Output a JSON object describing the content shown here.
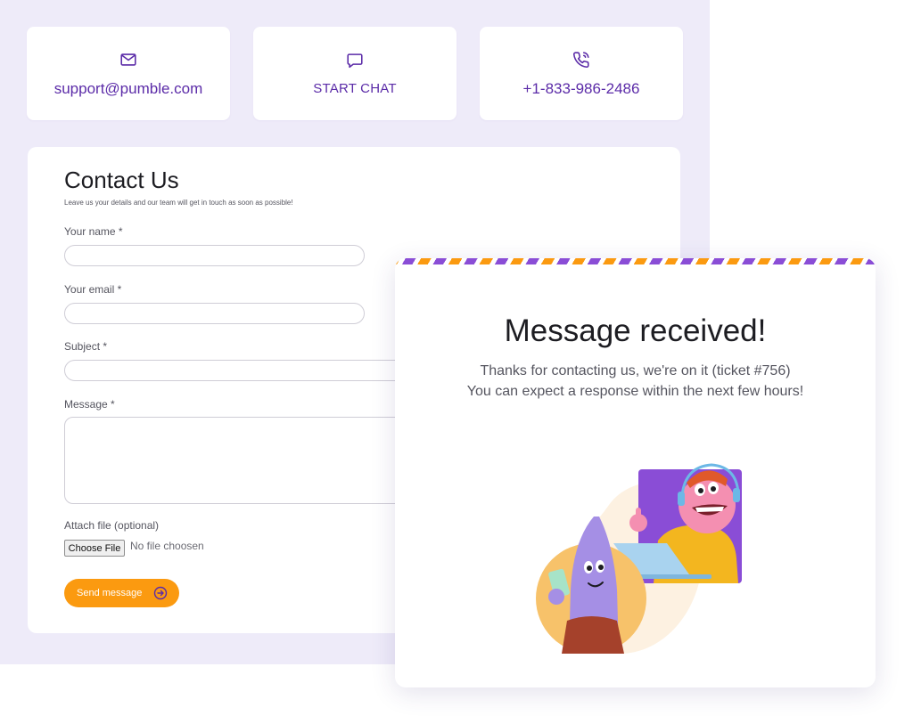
{
  "contacts": {
    "email": {
      "label": "support@pumble.com",
      "icon": "mail-icon"
    },
    "chat": {
      "label": "START CHAT",
      "icon": "chat-bubble-icon"
    },
    "phone": {
      "label": "+1-833-986-2486",
      "icon": "phone-call-icon"
    }
  },
  "form": {
    "title": "Contact Us",
    "subtitle": "Leave us your details and our team will get in touch as soon as possible!",
    "name_label": "Your name *",
    "email_label": "Your email *",
    "subject_label": "Subject *",
    "message_label": "Message *",
    "attach_label": "Attach file (optional)",
    "choose_file": "Choose File",
    "no_file": "No file choosen",
    "send_label": "Send message"
  },
  "modal": {
    "title": "Message received!",
    "line1": "Thanks for contacting us, we're on it (ticket #756)",
    "line2": "You can expect a response within the next few hours!"
  },
  "colors": {
    "accent_purple": "#5b2ba8",
    "accent_orange": "#fb9a10",
    "backdrop": "#eeebf9"
  }
}
